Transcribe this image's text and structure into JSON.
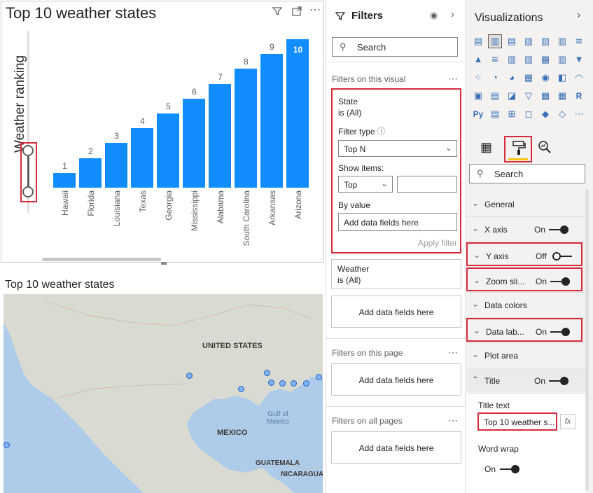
{
  "chart": {
    "title": "Top 10 weather states",
    "y_axis_title": "Weather ranking"
  },
  "chart_data": {
    "type": "bar",
    "title": "Top 10 weather states",
    "ylabel": "Weather ranking",
    "xlabel": "",
    "categories": [
      "Hawaii",
      "Florida",
      "Louisiana",
      "Texas",
      "Georgia",
      "Mississippi",
      "Alabama",
      "South Carolina",
      "Arkansas",
      "Arizona"
    ],
    "values": [
      1,
      2,
      3,
      4,
      5,
      6,
      7,
      8,
      9,
      10
    ],
    "data_labels": [
      "1",
      "2",
      "3",
      "4",
      "5",
      "6",
      "7",
      "8",
      "9",
      "10"
    ],
    "ylim": [
      0,
      10
    ],
    "grid": false,
    "color": "#118dff"
  },
  "map": {
    "title": "Top 10 weather states",
    "labels": {
      "us": "UNITED STATES",
      "gulf": "Gulf of Mexico",
      "mexico": "MEXICO",
      "guatemala": "GUATEMALA",
      "nicaragua": "NICARAGUA"
    }
  },
  "filters": {
    "title": "Filters",
    "search_placeholder": "Search",
    "on_visual_label": "Filters on this visual",
    "state_card": {
      "field": "State",
      "summary": "is (All)",
      "filter_type_label": "Filter type",
      "filter_type_value": "Top N",
      "show_items_label": "Show items:",
      "show_items_value": "Top",
      "count_value": "",
      "by_value_label": "By value",
      "by_value_placeholder": "Add data fields here",
      "apply": "Apply filter"
    },
    "weather_card": {
      "field": "Weather",
      "summary": "is (All)"
    },
    "add_fields": "Add data fields here",
    "on_page_label": "Filters on this page",
    "all_pages_label": "Filters on all pages"
  },
  "viz": {
    "title": "Visualizations",
    "search_placeholder": "Search",
    "more": "...",
    "properties": [
      {
        "label": "General",
        "type": "section"
      },
      {
        "label": "X axis",
        "state": "On",
        "on": true
      },
      {
        "label": "Y axis",
        "state": "Off",
        "on": false
      },
      {
        "label": "Zoom sli...",
        "state": "On",
        "on": true
      },
      {
        "label": "Data colors",
        "type": "section"
      },
      {
        "label": "Data lab...",
        "state": "On",
        "on": true
      },
      {
        "label": "Plot area",
        "type": "section"
      },
      {
        "label": "Title",
        "state": "On",
        "on": true
      }
    ],
    "title_text_label": "Title text",
    "title_text_value": "Top 10 weather s...",
    "fx": "fx",
    "word_wrap_label": "Word wrap",
    "word_wrap_state": "On"
  },
  "colors": {
    "accent": "#118dff",
    "highlight": "#d62b3d",
    "format_underline": "#f2c811"
  }
}
